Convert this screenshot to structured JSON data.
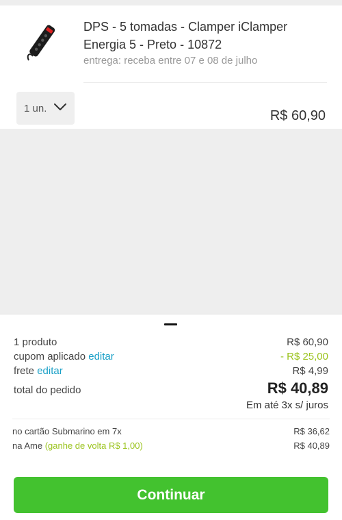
{
  "product": {
    "title": "DPS - 5 tomadas - Clamper iClamper Energia 5 - Preto - 10872",
    "delivery": "entrega: receba entre 07 e 08 de julho",
    "quantity_label": "1 un.",
    "price": "R$ 60,90"
  },
  "summary": {
    "products_label": "1 produto",
    "products_value": "R$ 60,90",
    "coupon_label": "cupom aplicado",
    "coupon_edit": "editar",
    "coupon_value": "- R$ 25,00",
    "shipping_label": "frete",
    "shipping_edit": "editar",
    "shipping_value": "R$ 4,99",
    "total_label": "total do pedido",
    "total_value": "R$ 40,89",
    "installments": "Em até 3x s/ juros"
  },
  "payment": {
    "card_label": "no cartão Submarino em 7x",
    "card_value": "R$ 36,62",
    "ame_label": "na Ame",
    "ame_cashback": "(ganhe de volta R$ 1,00)",
    "ame_value": "R$ 40,89"
  },
  "actions": {
    "continue_label": "Continuar"
  },
  "colors": {
    "accent_green": "#43c22f",
    "link_blue": "#1aa0c7",
    "discount_green": "#9ac31c"
  }
}
